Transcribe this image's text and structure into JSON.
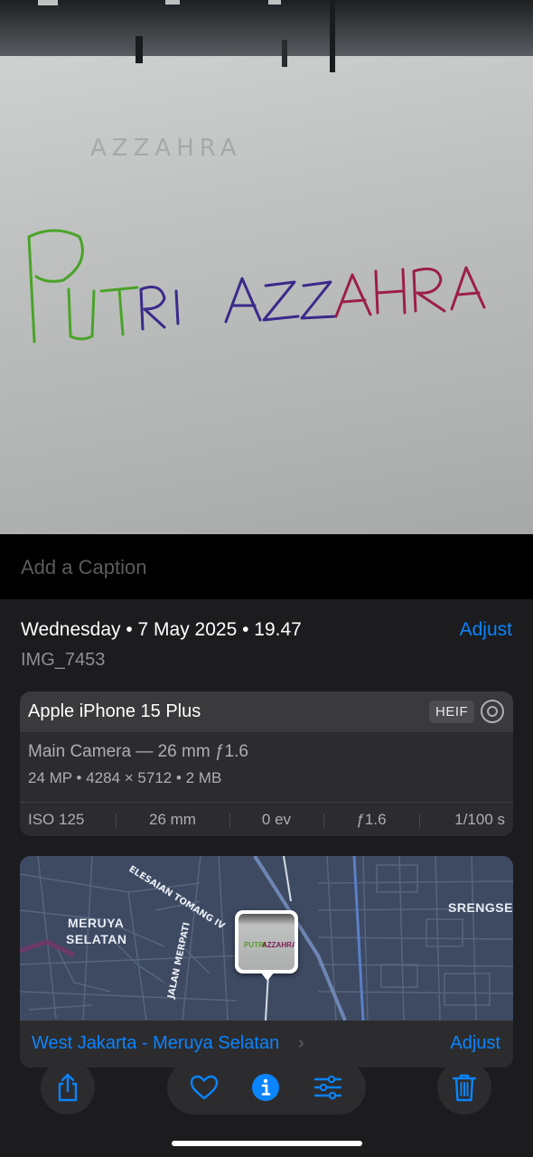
{
  "photo": {
    "handwriting_line1": "PUTRI",
    "handwriting_line2": "AZZAHRA",
    "faint_mirror_text": "AZZAHRA"
  },
  "caption": {
    "placeholder": "Add a Caption"
  },
  "info": {
    "date": "Wednesday • 7 May 2025 • 19.47",
    "adjust_label": "Adjust",
    "filename": "IMG_7453"
  },
  "camera": {
    "device": "Apple iPhone 15 Plus",
    "format_badge": "HEIF",
    "lens": "Main Camera — 26 mm ƒ1.6",
    "specs": "24 MP  •  4284 × 5712  •  2 MB",
    "exif": {
      "iso": "ISO 125",
      "focal": "26 mm",
      "ev": "0 ev",
      "aperture": "ƒ1.6",
      "shutter": "1/100 s"
    }
  },
  "map": {
    "labels": {
      "meruya": "MERUYA",
      "selatan": "SELATAN",
      "srengseng": "SRENGSEN",
      "street1": "ELESAIAN TOMANG IV",
      "street2": "JALAN MERPATI"
    },
    "thumb_text1": "PUTRI",
    "thumb_text2": "AZZAHRA",
    "place": "West Jakarta - Meruya Selatan",
    "chevron": "›",
    "adjust_label": "Adjust"
  },
  "toolbar": {
    "share": "share-icon",
    "favorite": "heart-icon",
    "info": "info-icon",
    "edit": "sliders-icon",
    "delete": "trash-icon"
  },
  "colors": {
    "accent": "#0a84ff",
    "panel": "#1c1c1e",
    "card": "#2c2c2e"
  }
}
